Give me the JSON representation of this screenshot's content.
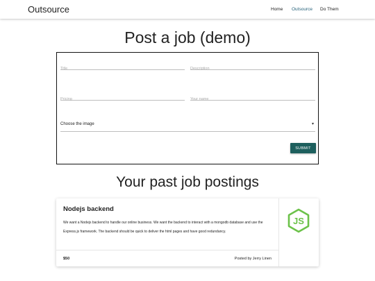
{
  "navbar": {
    "brand": "Outsource",
    "links": [
      {
        "label": "Home"
      },
      {
        "label": "Outsource"
      },
      {
        "label": "Do Them"
      }
    ]
  },
  "form": {
    "heading": "Post a job (demo)",
    "title_placeholder": "Title",
    "description_placeholder": "Description",
    "pricing_placeholder": "Pricing",
    "name_placeholder": "Your name",
    "image_select_value": "Choose the image",
    "submit_label": "SUBMIT"
  },
  "postings": {
    "heading": "Your past job postings",
    "cards": [
      {
        "title": "Nodejs backend",
        "description": "We want a Nodejs backend to handle our online business. We want the backend to interact with a mongodb database and use the Express.js framework. The backend should be quick to deliver the html pages and have good redundancy.",
        "price": "$50",
        "posted_by": "Posted by Jerry Linen",
        "logo_icon": "nodejs-logo-icon",
        "logo_color": "#6cc24a"
      }
    ]
  },
  "colors": {
    "active_link": "#26627a",
    "submit_bg": "#1d5f5d"
  }
}
